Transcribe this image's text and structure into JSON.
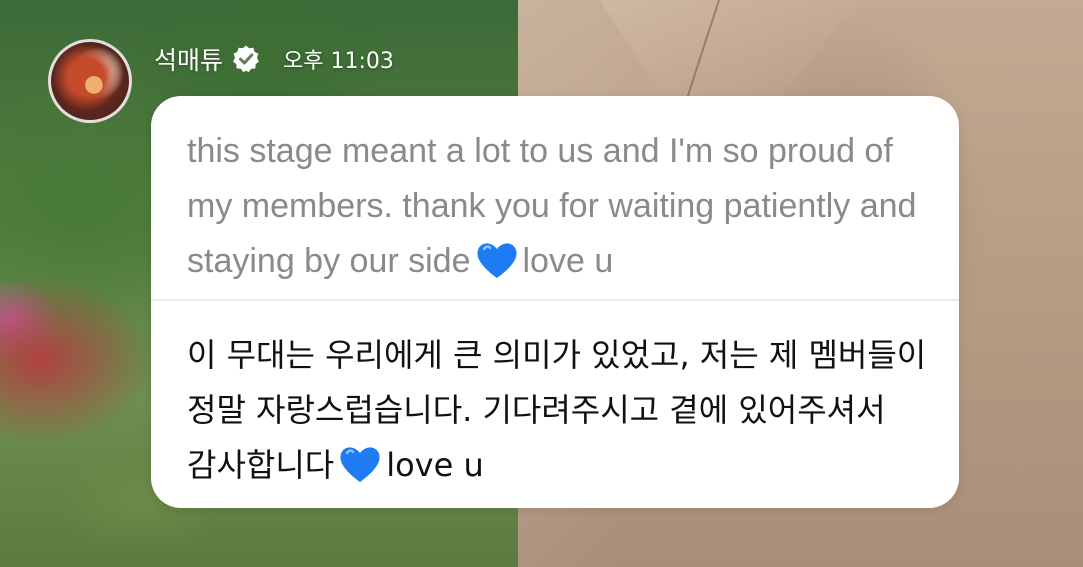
{
  "header": {
    "sender_name": "석매튜",
    "timestamp": "오후 11:03",
    "verified_icon": "verified-check-icon",
    "avatar_icon": "profile-avatar"
  },
  "message": {
    "original_before_heart": "this stage meant a lot to us and I'm so proud of my members. thank you for waiting patiently and staying by our side",
    "original_after_heart": "love u",
    "translated_before_heart": "이 무대는 우리에게 큰 의미가 있었고, 저는 제 멤버들이 정말 자랑스럽습니다. 기다려주시고 곁에 있어주셔서 감사합니다",
    "translated_after_heart": "love u",
    "heart_icon": "blue-heart-emoji"
  },
  "colors": {
    "bubble_bg": "#ffffff",
    "original_text": "#8a8a8a",
    "translated_text": "#111111",
    "heart": "#1e7bf2",
    "verified_badge": "#ffffff"
  }
}
